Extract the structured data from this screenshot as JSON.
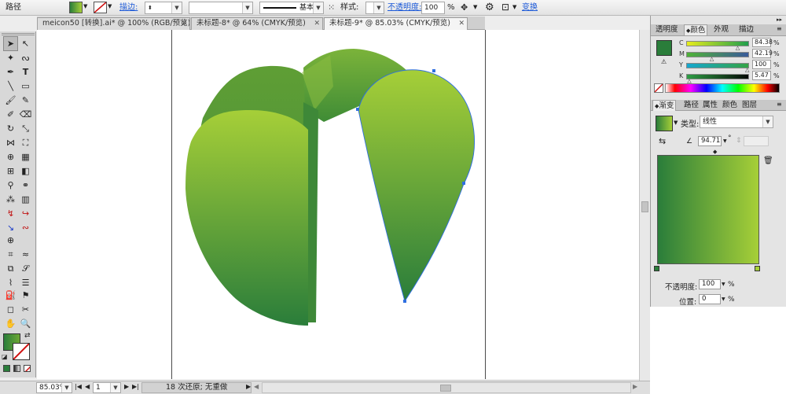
{
  "toolbar": {
    "object_type": "路径",
    "stroke_label": "描边:",
    "stroke_profile": "基本",
    "style_label": "样式:",
    "opacity_label": "不透明度:",
    "opacity_value": "100",
    "opacity_unit": "%",
    "transform_label": "变换"
  },
  "tabs": [
    {
      "label": "meicon50 [转换].ai* @ 100% (RGB/预览)"
    },
    {
      "label": "未标题-8* @ 64% (CMYK/预览)"
    },
    {
      "label": "未标题-9* @ 85.03% (CMYK/预览)"
    }
  ],
  "status": {
    "zoom": "85.03%",
    "page": "1",
    "history": "18 次还原; 无重做"
  },
  "color_panel": {
    "tabs": [
      "透明度",
      "颜色",
      "外观",
      "描边"
    ],
    "channels": [
      {
        "label": "C",
        "value": "84.38",
        "pos": 84.38
      },
      {
        "label": "M",
        "value": "42.19",
        "pos": 42.19
      },
      {
        "label": "Y",
        "value": "100",
        "pos": 100
      },
      {
        "label": "K",
        "value": "5.47",
        "pos": 5.47
      }
    ],
    "percent": "%"
  },
  "gradient_panel": {
    "tabs": [
      "渐变",
      "路径",
      "属性",
      "颜色",
      "图层"
    ],
    "type_label": "类型:",
    "type_value": "线性",
    "angle_value": "94.71",
    "degree": "°",
    "opacity_label": "不透明度:",
    "opacity_value": "100",
    "location_label": "位置:",
    "location_value": "0",
    "percent": "%"
  },
  "colors": {
    "dark_green": "#2a7d3a",
    "light_green": "#a6cf38",
    "selection_blue": "#2f6fe0"
  }
}
